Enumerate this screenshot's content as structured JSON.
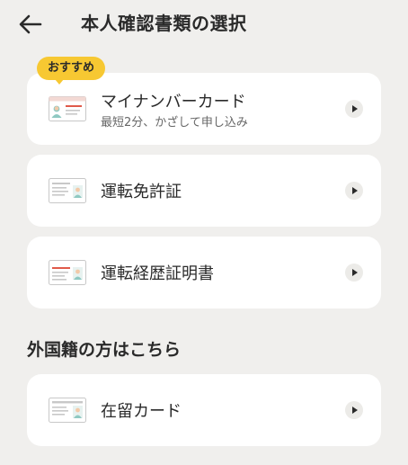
{
  "header": {
    "title": "本人確認書類の選択",
    "back_icon": "arrow-left-icon"
  },
  "recommend_badge": "おすすめ",
  "documents": [
    {
      "label": "マイナンバーカード",
      "sub": "最短2分、かざして申し込み",
      "icon": "mynumber-card-icon"
    },
    {
      "label": "運転免許証",
      "icon": "drivers-license-icon"
    },
    {
      "label": "運転経歴証明書",
      "icon": "driving-history-certificate-icon"
    }
  ],
  "foreign_section": {
    "title": "外国籍の方はこちら",
    "items": [
      {
        "label": "在留カード",
        "icon": "residence-card-icon"
      }
    ]
  },
  "colors": {
    "background": "#f0efed",
    "card": "#ffffff",
    "badge": "#f7c832",
    "accent_red": "#e05a4a"
  }
}
